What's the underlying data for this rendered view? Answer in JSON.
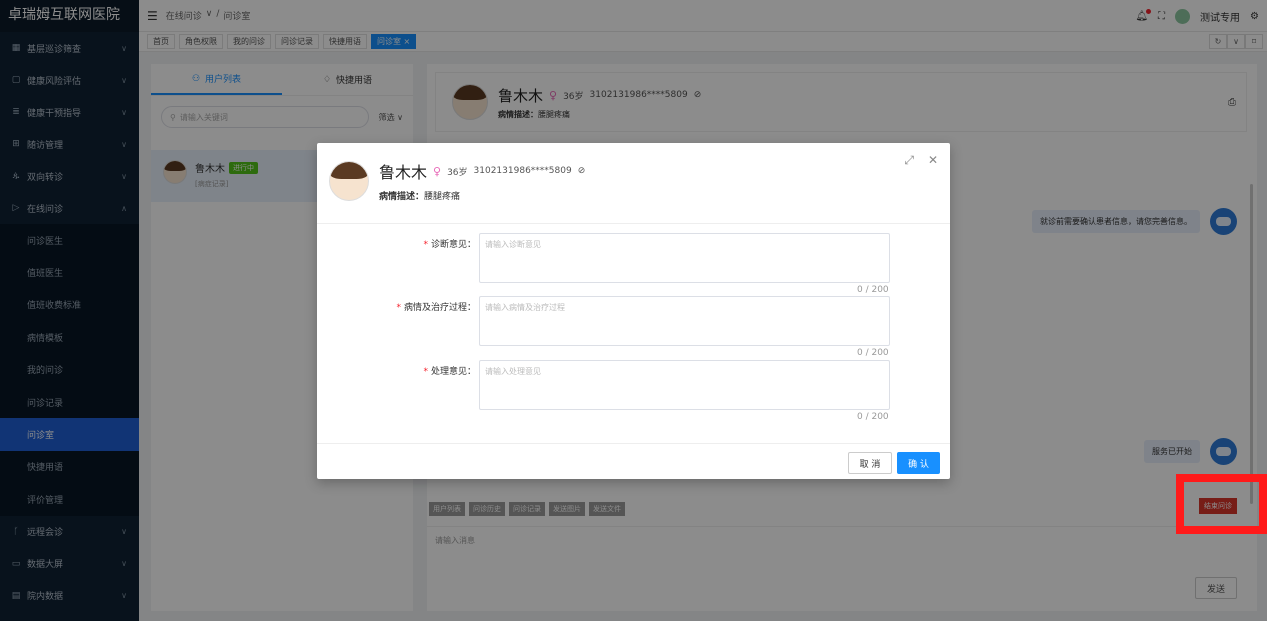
{
  "app": {
    "title": "卓瑞姆互联网医院"
  },
  "sidebar": {
    "items": [
      {
        "label": "基层巡诊筛查",
        "icon": "grid-icon"
      },
      {
        "label": "健康风险评估",
        "icon": "doc-icon"
      },
      {
        "label": "健康干预指导",
        "icon": "list-icon"
      },
      {
        "label": "随访管理",
        "icon": "calendar-icon"
      },
      {
        "label": "双向转诊",
        "icon": "users-icon"
      },
      {
        "label": "在线问诊",
        "icon": "send-icon"
      }
    ],
    "sub_items": [
      "问诊医生",
      "值班医生",
      "值班收费标准",
      "病情模板",
      "我的问诊",
      "问诊记录",
      "问诊室",
      "快捷用语",
      "评价管理"
    ],
    "active_sub": "问诊室",
    "bottom_items": [
      {
        "label": "远程会诊",
        "icon": "branch-icon"
      },
      {
        "label": "数据大屏",
        "icon": "screen-icon"
      },
      {
        "label": "院内数据",
        "icon": "table-icon"
      }
    ]
  },
  "topbar": {
    "breadcrumb": [
      "在线问诊",
      "/",
      "问诊室"
    ],
    "username": "测试专用"
  },
  "tabs": [
    "首页",
    "角色权限",
    "我的问诊",
    "问诊记录",
    "快捷用语",
    "问诊室 ×"
  ],
  "user_panel": {
    "tab_users": "用户列表",
    "tab_phrases": "快捷用语",
    "search_placeholder": "请输入关键词",
    "filter_label": "筛选 ∨",
    "user": {
      "name": "鲁木木",
      "status": "进行中",
      "sub": "[病症记录]"
    }
  },
  "chat": {
    "patient_name": "鲁木木",
    "age": "36岁",
    "id_masked": "3102131986****5809",
    "desc_label": "病情描述：",
    "desc_value": "腰腿疼痛",
    "messages": [
      "就诊前需要确认患者信息，请您完善信息。",
      "服务已开始"
    ],
    "tools": [
      "用户列表",
      "问诊历史",
      "问诊记录",
      "发送图片",
      "发送文件"
    ],
    "end_button": "结束问诊",
    "input_placeholder": "请输入消息",
    "send_button": "发送"
  },
  "modal": {
    "name": "鲁木木",
    "age": "36岁",
    "id_masked": "3102131986****5809",
    "desc_label": "病情描述：",
    "desc_value": "腰腿疼痛",
    "fields": [
      {
        "label": "诊断意见：",
        "placeholder": "请输入诊断意见",
        "counter": "0 / 200"
      },
      {
        "label": "病情及治疗过程：",
        "placeholder": "请输入病情及治疗过程",
        "counter": "0 / 200"
      },
      {
        "label": "处理意见：",
        "placeholder": "请输入处理意见",
        "counter": "0 / 200"
      }
    ],
    "cancel": "取 消",
    "ok": "确 认"
  }
}
